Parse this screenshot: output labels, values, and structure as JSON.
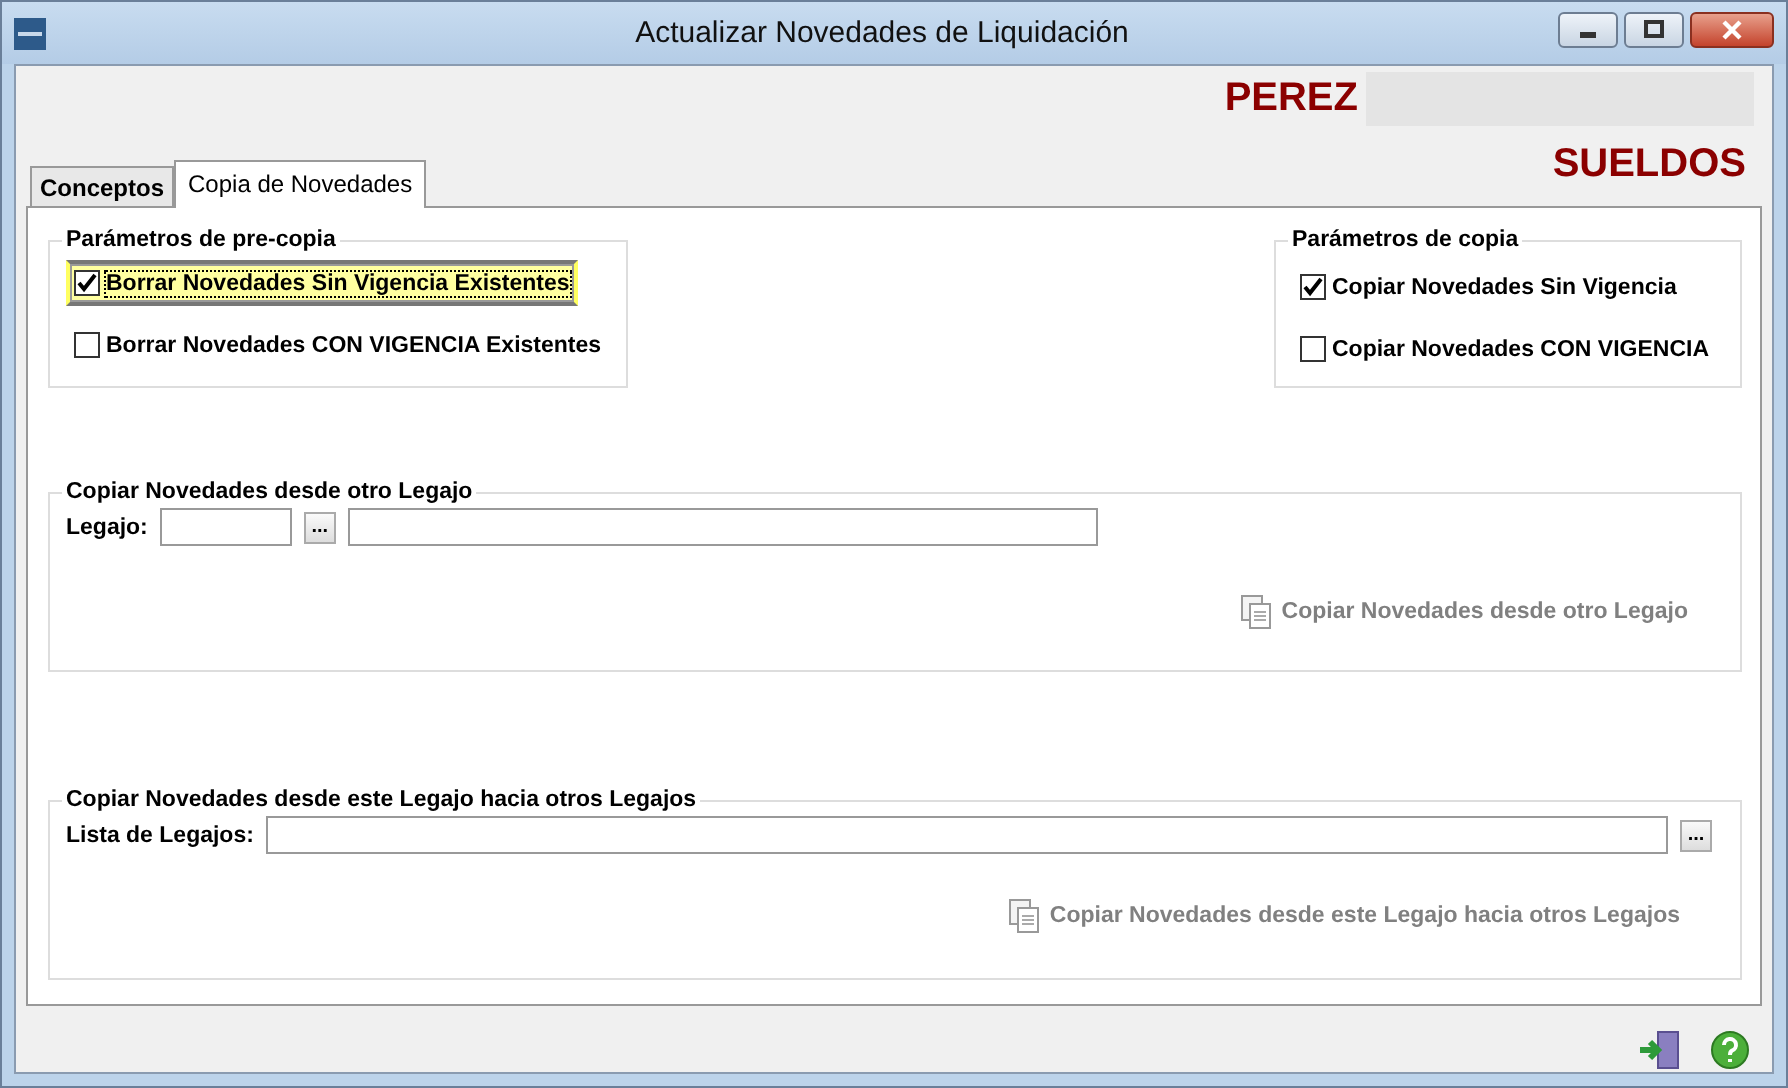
{
  "window": {
    "title": "Actualizar Novedades de Liquidación"
  },
  "header": {
    "name": "PEREZ",
    "module": "SUELDOS"
  },
  "tabs": [
    {
      "label": "Conceptos",
      "selected": false
    },
    {
      "label": "Copia de Novedades",
      "selected": true
    }
  ],
  "pre_copy": {
    "title": "Parámetros de pre-copia",
    "options": [
      {
        "label": "Borrar Novedades Sin Vigencia Existentes",
        "checked": true,
        "focused": true
      },
      {
        "label": "Borrar Novedades CON VIGENCIA Existentes",
        "checked": false,
        "focused": false
      }
    ]
  },
  "copy": {
    "title": "Parámetros de copia",
    "options": [
      {
        "label": "Copiar Novedades Sin Vigencia",
        "checked": true,
        "focused": false
      },
      {
        "label": "Copiar Novedades CON VIGENCIA",
        "checked": false,
        "focused": false
      }
    ]
  },
  "from_other": {
    "title": "Copiar Novedades desde otro Legajo",
    "field_label": "Legajo:",
    "browse": "...",
    "action": {
      "label": "Copiar Novedades desde otro Legajo",
      "disabled": true
    }
  },
  "to_others": {
    "title": "Copiar Novedades desde este Legajo hacia otros Legajos",
    "field_label": "Lista de Legajos:",
    "browse": "...",
    "action": {
      "label": "Copiar Novedades desde este Legajo hacia otros Legajos",
      "disabled": true
    }
  }
}
